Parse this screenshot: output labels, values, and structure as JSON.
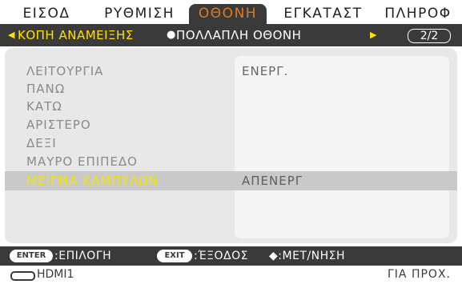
{
  "tabs": [
    {
      "label": "ΕΙΣΟΔ",
      "active": false
    },
    {
      "label": "ΡΥΘΜΙΣΗ",
      "active": false
    },
    {
      "label": "ΟΘΟΝΗ",
      "active": true
    },
    {
      "label": "ΕΓΚΑΤΑΣΤ",
      "active": false
    },
    {
      "label": "ΠΛΗΡΟΦ",
      "active": false
    }
  ],
  "submenu": {
    "left_arrow": "◀",
    "item1": "ΚΟΠΗ ΑΝΑΜΕΙΞΗΣ",
    "separator": "●",
    "item2": "ΠΟΛΛΑΠΛΗ ΟΘΟΝΗ",
    "right_arrow": "▶",
    "page": "2/2"
  },
  "rows": [
    {
      "label": "ΛΕΙΤΟΥΡΓΙΑ",
      "value": "ΕΝΕΡΓ."
    },
    {
      "label": "ΠΑΝΩ",
      "value": ""
    },
    {
      "label": "ΚΑΤΩ",
      "value": ""
    },
    {
      "label": "ΑΡΙΣΤΕΡΟ",
      "value": ""
    },
    {
      "label": "ΔΕΞΙ",
      "value": ""
    },
    {
      "label": "ΜΑΥΡΟ ΕΠΙΠΕΔΟ",
      "value": ""
    },
    {
      "label": "ΜΕΙΓΜΑ ΚΑΜΠΥΛΩΝ",
      "value": "ΑΠΕΝΕΡΓ",
      "selected": true
    }
  ],
  "help": {
    "enter_key": "ENTER",
    "enter_text": ":ΕΠΙΛΟΓΗ",
    "exit_key": "EXIT",
    "exit_text": ":ΈΞΟΔΟΣ",
    "move_text": "◆:ΜΕΤ/ΝΗΣΗ"
  },
  "status": {
    "input_icon": "hdmi-connector-icon",
    "input": "HDMI1",
    "info": "ΓΙΑ ΠΡΟΧ."
  },
  "colors": {
    "bar": "#3a3a3a",
    "active_tab_text": "#e07a1f",
    "highlight": "#ffe000",
    "panel": "#e8e8e8",
    "selected_row": "#c9c9c9"
  }
}
